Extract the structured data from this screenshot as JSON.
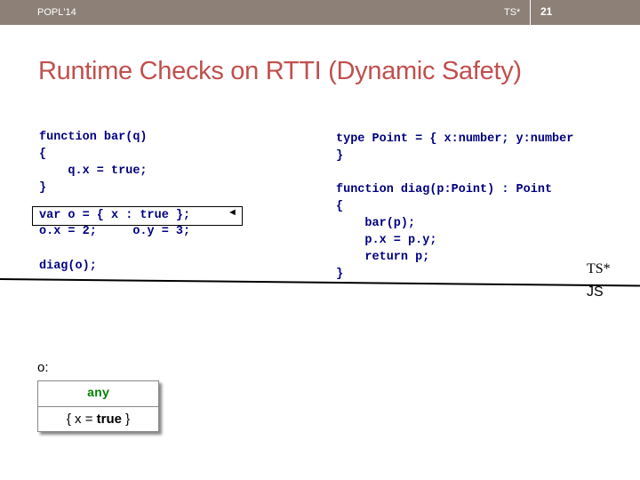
{
  "header": {
    "left": "POPL'14",
    "middle": "TS*",
    "page_number": "21"
  },
  "title": "Runtime Checks on RTTI (Dynamic Safety)",
  "left_code": {
    "fn_header": "function bar(q)",
    "open_brace": "{",
    "body_prefix": "    q.x = ",
    "body_value": "true",
    "body_suffix": ";",
    "close_brace": "}",
    "decl": "var o = { x : true };",
    "assign": "o.x = 2;     o.y = 3;",
    "call": "diag(o);"
  },
  "right_code": {
    "type_decl": "type Point = { x:number; y:number",
    "type_close": "}",
    "fn_header": "function diag(p:Point) : Point",
    "open_brace": "{",
    "line1": "    bar(p);",
    "line2": "    p.x = p.y;",
    "line3": "    return p;",
    "close_brace": "}"
  },
  "labels": {
    "ts": "TS*",
    "js": "JS",
    "o": "o:"
  },
  "object_box": {
    "header": "any",
    "open": "{ x = ",
    "value": "true",
    "close": " }"
  },
  "colors": {
    "title": "#c0504d",
    "code": "#000080",
    "type_tag": "#008000",
    "topbar": "#8c8077"
  }
}
